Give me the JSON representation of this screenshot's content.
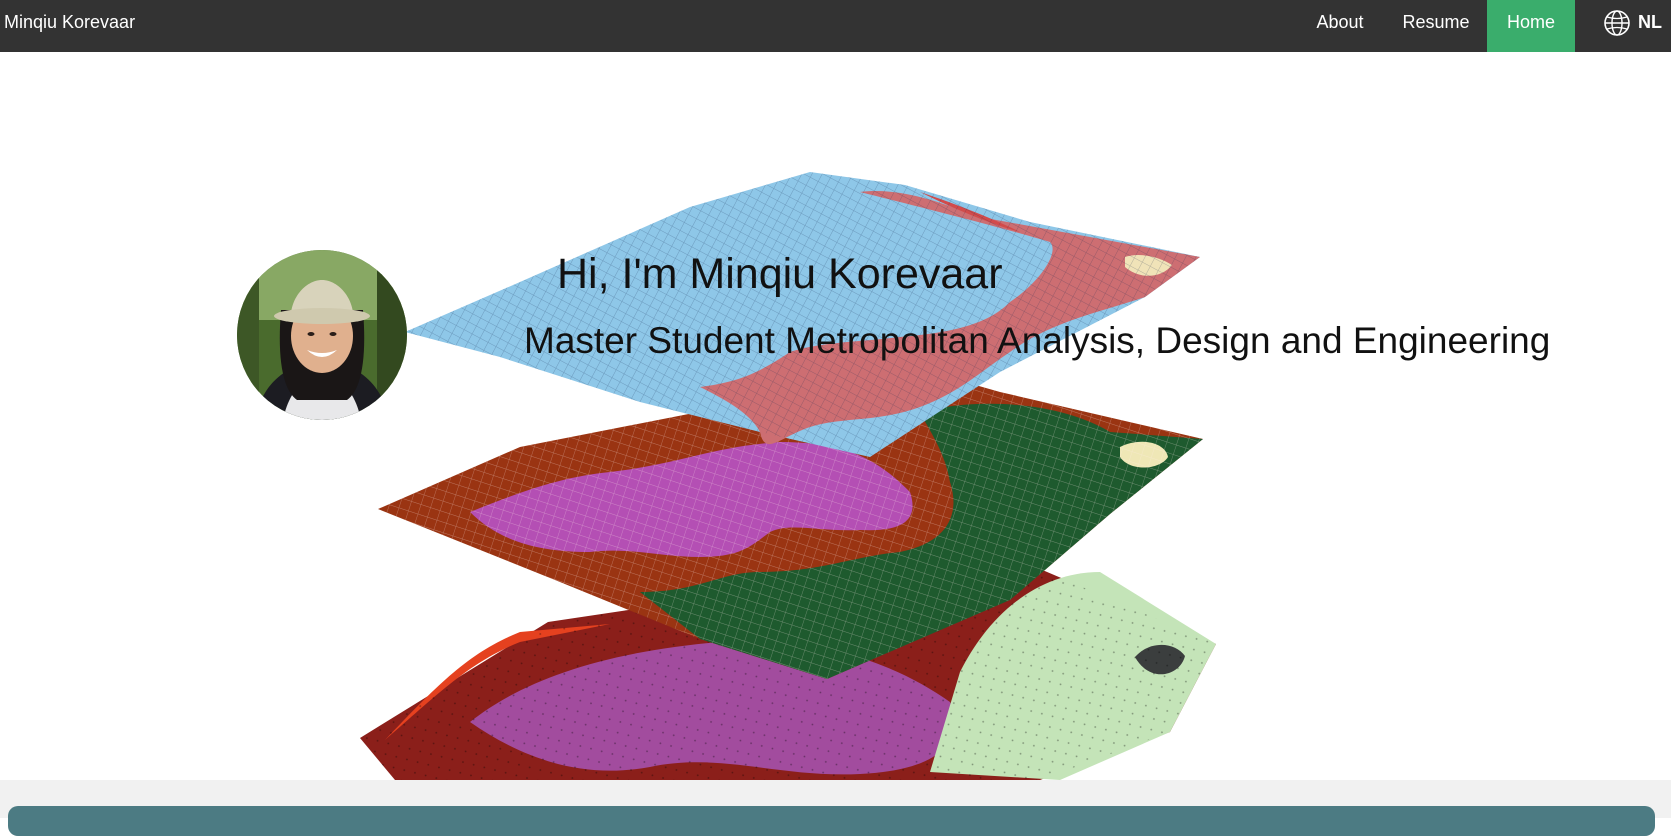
{
  "nav": {
    "brand": "Minqiu Korevaar",
    "items": [
      {
        "label": "About",
        "active": false
      },
      {
        "label": "Resume",
        "active": false
      },
      {
        "label": "Home",
        "active": true
      }
    ],
    "language": {
      "label": "NL",
      "icon": "globe-icon"
    }
  },
  "hero": {
    "title": "Hi, I'm Minqiu Korevaar",
    "subtitle": "Master Student Metropolitan Analysis, Design and Engineering",
    "avatar_icon": "profile-photo",
    "background": "layered-terrain-map-illustration"
  },
  "colors": {
    "navbar": "#333333",
    "active_tab": "#3aad6c",
    "card": "#4c7b83",
    "strip": "#f1f1f1",
    "layer_top_blue": "#8ec7e8",
    "layer_top_red": "#cd6e72",
    "layer_mid_brown": "#9a3412",
    "layer_mid_purple": "#b44fb4",
    "layer_mid_green": "#1e5a2e",
    "layer_bottom_maroon": "#8b1f1a",
    "layer_bottom_purple": "#a24c9e",
    "layer_bottom_lightgreen": "#c4e4b8"
  }
}
